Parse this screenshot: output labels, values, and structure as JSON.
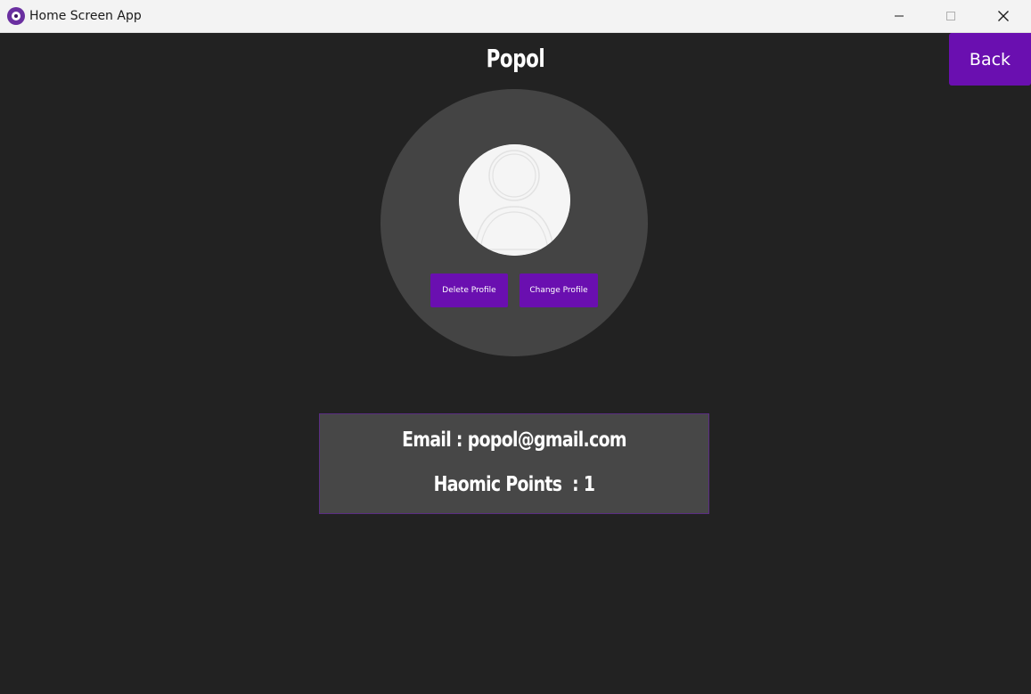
{
  "window": {
    "title": "Home Screen App",
    "app_icon": "app-logo-icon",
    "controls": {
      "minimize_icon": "minimize-icon",
      "maximize_icon": "maximize-icon",
      "close_icon": "close-icon"
    }
  },
  "header": {
    "back_label": "Back"
  },
  "profile": {
    "name": "Popol",
    "avatar_icon": "user-placeholder-icon",
    "delete_label": "Delete Profile",
    "change_label": "Change Profile"
  },
  "info": {
    "email_line": "Email : popol@gmail.com",
    "points_line": "Haomic Points  : 1"
  },
  "colors": {
    "background": "#222222",
    "panel": "#444444",
    "accent": "#6a0fb0",
    "info_border": "#5a2d82",
    "text": "#ffffff"
  }
}
